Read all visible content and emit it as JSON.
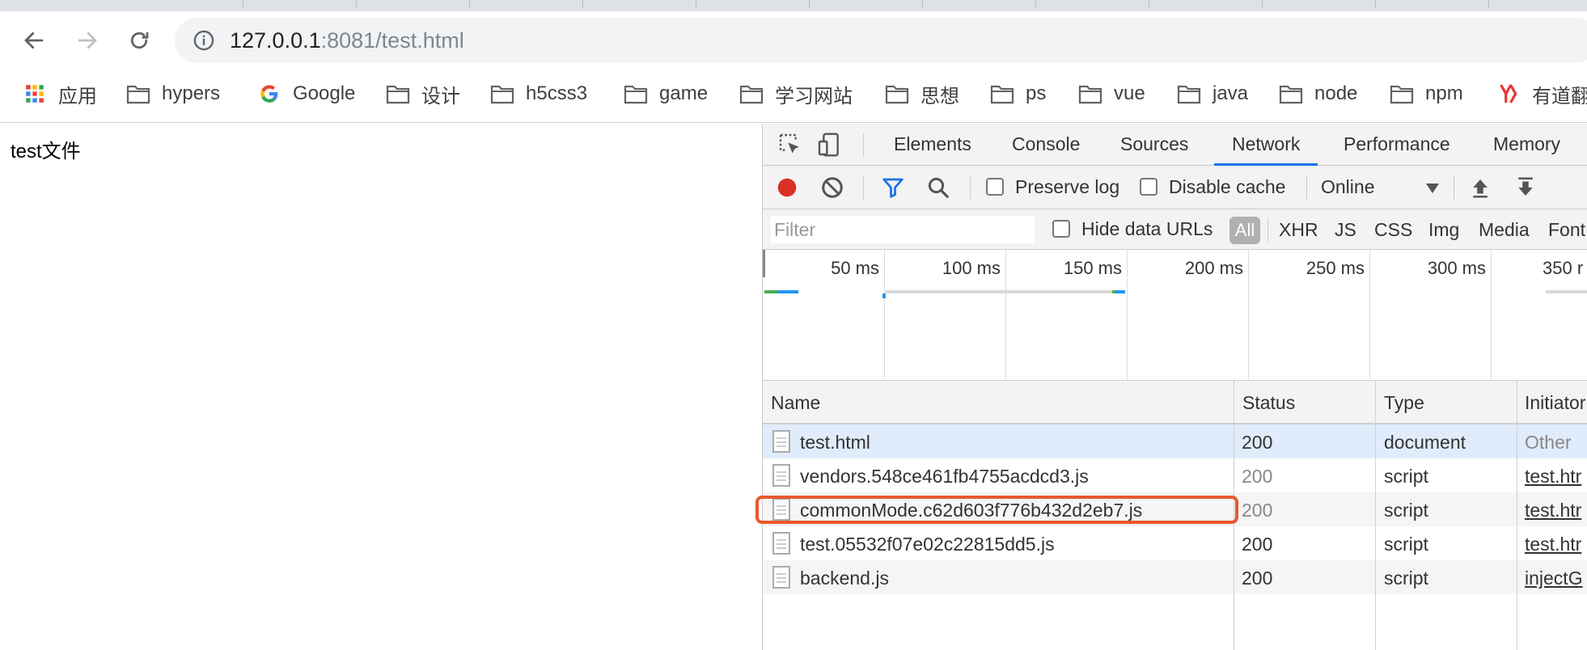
{
  "browser": {
    "url_host": "127.0.0.1",
    "url_rest": ":8081/test.html"
  },
  "bookmarks": [
    {
      "label": "应用",
      "icon": "apps-grid-icon"
    },
    {
      "label": "hypers",
      "icon": "folder-icon"
    },
    {
      "label": "Google",
      "icon": "google-icon"
    },
    {
      "label": "设计",
      "icon": "folder-icon"
    },
    {
      "label": "h5css3",
      "icon": "folder-icon"
    },
    {
      "label": "game",
      "icon": "folder-icon"
    },
    {
      "label": "学习网站",
      "icon": "folder-icon"
    },
    {
      "label": "思想",
      "icon": "folder-icon"
    },
    {
      "label": "ps",
      "icon": "folder-icon"
    },
    {
      "label": "vue",
      "icon": "folder-icon"
    },
    {
      "label": "java",
      "icon": "folder-icon"
    },
    {
      "label": "node",
      "icon": "folder-icon"
    },
    {
      "label": "npm",
      "icon": "folder-icon"
    },
    {
      "label": "有道翻",
      "icon": "youdao-icon"
    }
  ],
  "page": {
    "text": "test文件"
  },
  "devtools": {
    "tabs": [
      "Elements",
      "Console",
      "Sources",
      "Network",
      "Performance",
      "Memory"
    ],
    "active_tab": "Network",
    "toolbar": {
      "preserve_log": "Preserve log",
      "disable_cache": "Disable cache",
      "throttle": "Online"
    },
    "filter": {
      "placeholder": "Filter",
      "hide_data_urls": "Hide data URLs",
      "all": "All",
      "types": [
        "XHR",
        "JS",
        "CSS",
        "Img",
        "Media",
        "Font"
      ]
    },
    "timeline": {
      "ticks": [
        "50 ms",
        "100 ms",
        "150 ms",
        "200 ms",
        "250 ms",
        "300 ms",
        "350 r"
      ]
    },
    "table": {
      "headers": [
        "Name",
        "Status",
        "Type",
        "Initiator"
      ],
      "rows": [
        {
          "name": "test.html",
          "status": "200",
          "type": "document",
          "initiator": "Other"
        },
        {
          "name": "vendors.548ce461fb4755acdcd3.js",
          "status": "200",
          "type": "script",
          "initiator": "test.htr"
        },
        {
          "name": "commonMode.c62d603f776b432d2eb7.js",
          "status": "200",
          "type": "script",
          "initiator": "test.htr"
        },
        {
          "name": "test.05532f07e02c22815dd5.js",
          "status": "200",
          "type": "script",
          "initiator": "test.htr"
        },
        {
          "name": "backend.js",
          "status": "200",
          "type": "script",
          "initiator": "injectG"
        }
      ]
    },
    "colors": {
      "record": "#d93025",
      "active_tab_underline": "#1a73e8",
      "highlight": "#e8582d",
      "selected_row": "#e0ecfb"
    }
  }
}
